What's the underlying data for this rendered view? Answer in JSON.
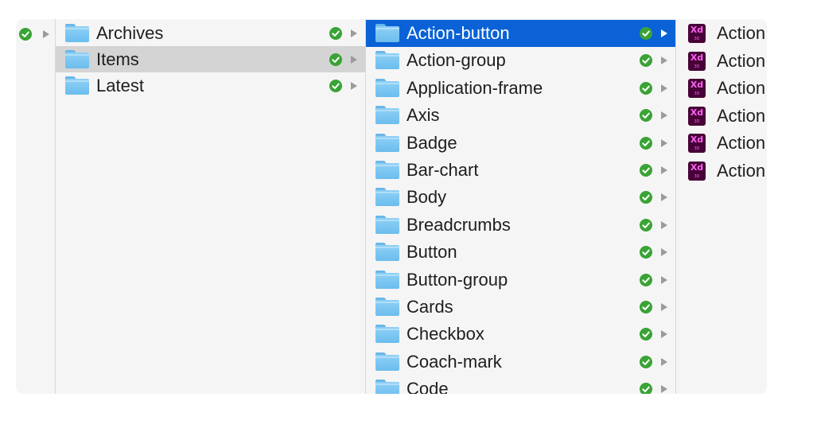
{
  "theme": {
    "selection_color": "#0a62d6",
    "highlight_color": "#d4d4d4",
    "status_color": "#3aa335",
    "folder_color": "#7cc7f2"
  },
  "columns": [
    {
      "items": [
        {
          "label": "",
          "status": "synced",
          "has_children": true
        }
      ]
    },
    {
      "items": [
        {
          "label": "Archives",
          "icon": "folder-icon",
          "status": "synced",
          "has_children": true
        },
        {
          "label": "Items",
          "icon": "folder-icon",
          "status": "synced",
          "has_children": true,
          "state": "highlighted"
        },
        {
          "label": "Latest",
          "icon": "folder-icon",
          "status": "synced",
          "has_children": true
        }
      ]
    },
    {
      "items": [
        {
          "label": "Action-button",
          "icon": "folder-icon",
          "status": "synced",
          "has_children": true,
          "state": "selected"
        },
        {
          "label": "Action-group",
          "icon": "folder-icon",
          "status": "synced",
          "has_children": true
        },
        {
          "label": "Application-frame",
          "icon": "folder-icon",
          "status": "synced",
          "has_children": true
        },
        {
          "label": "Axis",
          "icon": "folder-icon",
          "status": "synced",
          "has_children": true
        },
        {
          "label": "Badge",
          "icon": "folder-icon",
          "status": "synced",
          "has_children": true
        },
        {
          "label": "Bar-chart",
          "icon": "folder-icon",
          "status": "synced",
          "has_children": true
        },
        {
          "label": "Body",
          "icon": "folder-icon",
          "status": "synced",
          "has_children": true
        },
        {
          "label": "Breadcrumbs",
          "icon": "folder-icon",
          "status": "synced",
          "has_children": true
        },
        {
          "label": "Button",
          "icon": "folder-icon",
          "status": "synced",
          "has_children": true
        },
        {
          "label": "Button-group",
          "icon": "folder-icon",
          "status": "synced",
          "has_children": true
        },
        {
          "label": "Cards",
          "icon": "folder-icon",
          "status": "synced",
          "has_children": true
        },
        {
          "label": "Checkbox",
          "icon": "folder-icon",
          "status": "synced",
          "has_children": true
        },
        {
          "label": "Coach-mark",
          "icon": "folder-icon",
          "status": "synced",
          "has_children": true
        },
        {
          "label": "Code",
          "icon": "folder-icon",
          "status": "synced",
          "has_children": true
        }
      ]
    },
    {
      "items": [
        {
          "label": "Action",
          "icon": "xd-file-icon",
          "icon_text": "Xd",
          "icon_subtext": "3D"
        },
        {
          "label": "Action",
          "icon": "xd-file-icon",
          "icon_text": "Xd",
          "icon_subtext": "3D"
        },
        {
          "label": "Action",
          "icon": "xd-file-icon",
          "icon_text": "Xd",
          "icon_subtext": "3D"
        },
        {
          "label": "Action",
          "icon": "xd-file-icon",
          "icon_text": "Xd",
          "icon_subtext": "3D"
        },
        {
          "label": "Action",
          "icon": "xd-file-icon",
          "icon_text": "Xd",
          "icon_subtext": "3D"
        },
        {
          "label": "Action",
          "icon": "xd-file-icon",
          "icon_text": "Xd",
          "icon_subtext": "3D"
        }
      ]
    }
  ]
}
